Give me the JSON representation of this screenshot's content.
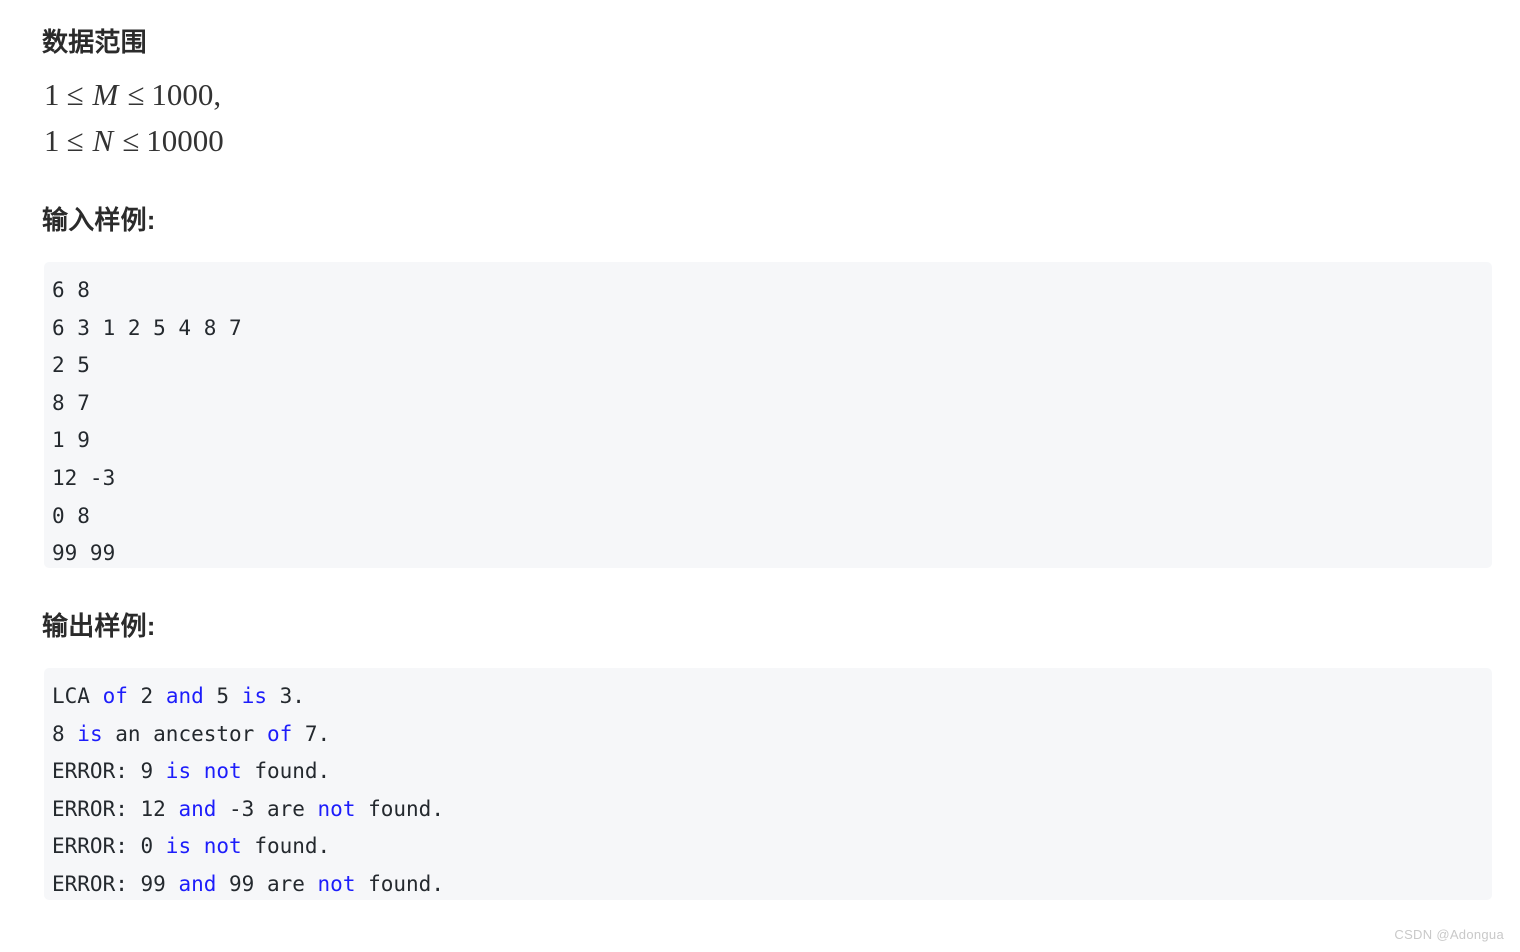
{
  "sections": {
    "range": {
      "heading": "数据范围",
      "constraints": [
        {
          "lower": "1",
          "rel1": "≤",
          "var": "M",
          "rel2": "≤",
          "upper": "1000,"
        },
        {
          "lower": "1",
          "rel1": "≤",
          "var": "N",
          "rel2": "≤",
          "upper": "10000"
        }
      ]
    },
    "input_sample": {
      "heading": "输入样例:",
      "lines": [
        "6 8",
        "6 3 1 2 5 4 8 7",
        "2 5",
        "8 7",
        "1 9",
        "12 -3",
        "0 8",
        "99 99"
      ]
    },
    "output_sample": {
      "heading": "输出样例:",
      "lines": [
        [
          {
            "t": "LCA ",
            "kw": false
          },
          {
            "t": "of",
            "kw": true
          },
          {
            "t": " 2 ",
            "kw": false
          },
          {
            "t": "and",
            "kw": true
          },
          {
            "t": " 5 ",
            "kw": false
          },
          {
            "t": "is",
            "kw": true
          },
          {
            "t": " 3.",
            "kw": false
          }
        ],
        [
          {
            "t": "8 ",
            "kw": false
          },
          {
            "t": "is",
            "kw": true
          },
          {
            "t": " an ancestor ",
            "kw": false
          },
          {
            "t": "of",
            "kw": true
          },
          {
            "t": " 7.",
            "kw": false
          }
        ],
        [
          {
            "t": "ERROR: 9 ",
            "kw": false
          },
          {
            "t": "is",
            "kw": true
          },
          {
            "t": " ",
            "kw": false
          },
          {
            "t": "not",
            "kw": true
          },
          {
            "t": " found.",
            "kw": false
          }
        ],
        [
          {
            "t": "ERROR: 12 ",
            "kw": false
          },
          {
            "t": "and",
            "kw": true
          },
          {
            "t": " -3 are ",
            "kw": false
          },
          {
            "t": "not",
            "kw": true
          },
          {
            "t": " found.",
            "kw": false
          }
        ],
        [
          {
            "t": "ERROR: 0 ",
            "kw": false
          },
          {
            "t": "is",
            "kw": true
          },
          {
            "t": " ",
            "kw": false
          },
          {
            "t": "not",
            "kw": true
          },
          {
            "t": " found.",
            "kw": false
          }
        ],
        [
          {
            "t": "ERROR: 99 ",
            "kw": false
          },
          {
            "t": "and",
            "kw": true
          },
          {
            "t": " 99 are ",
            "kw": false
          },
          {
            "t": "not",
            "kw": true
          },
          {
            "t": " found.",
            "kw": false
          }
        ]
      ]
    }
  },
  "watermark": "CSDN @Adongua",
  "colors": {
    "code_background": "#f6f7f9",
    "keyword": "#1d1dfb",
    "text": "#24292e",
    "heading": "#2b2b2b",
    "watermark": "#c9c9c9"
  }
}
